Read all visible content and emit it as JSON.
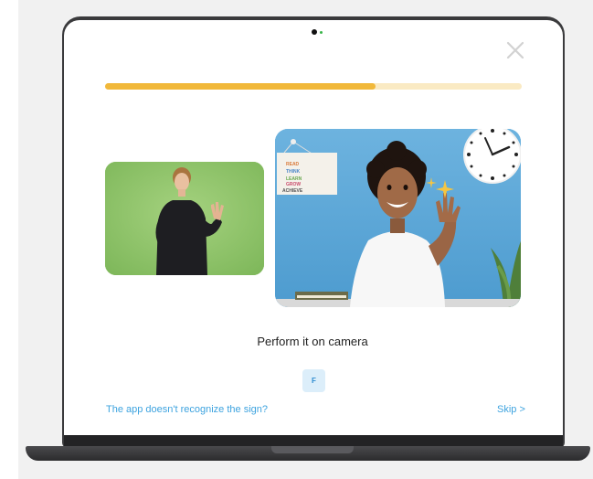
{
  "lesson": {
    "progress_percent": 65,
    "instruction": "Perform it on camera",
    "letter": "F",
    "help_link": "The app doesn't recognize the sign?",
    "skip_label": "Skip >"
  },
  "camera_feed": {
    "poster_text": "READ THINK LEARN GROW ACHIEVE"
  },
  "colors": {
    "progress_fill": "#f1b83a",
    "progress_track": "#faeac3",
    "link": "#3da3df",
    "ref_video_bg": "#8fc46c",
    "camera_bg": "#5ba8d6"
  },
  "icons": [
    "close-icon",
    "webcam-icon"
  ]
}
